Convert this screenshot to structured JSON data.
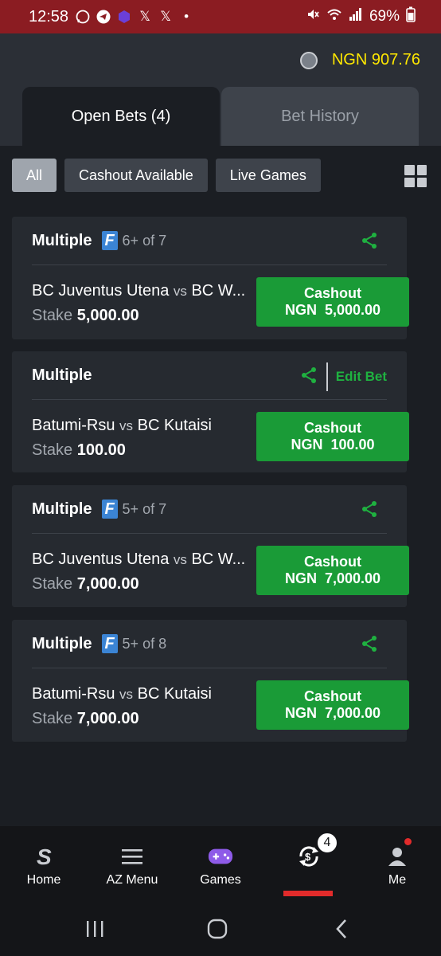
{
  "status_bar": {
    "time": "12:58",
    "battery": "69%",
    "app_icons": [
      "whatsapp-icon",
      "telegram-icon",
      "app-icon",
      "x-icon",
      "x-icon",
      "dot"
    ]
  },
  "header": {
    "balance": "NGN 907.76"
  },
  "tabs": [
    {
      "label": "Open Bets (4)",
      "active": true
    },
    {
      "label": "Bet History",
      "active": false
    }
  ],
  "filters": [
    {
      "label": "All",
      "active": true
    },
    {
      "label": "Cashout Available",
      "active": false
    },
    {
      "label": "Live Games",
      "active": false
    }
  ],
  "bets": [
    {
      "type": "Multiple",
      "badge": "F",
      "of": "6+ of 7",
      "home": "BC Juventus Utena",
      "vs": "vs",
      "away": "BC W...",
      "stake_label": "Stake",
      "stake": "5,000.00",
      "cashout_label": "Cashout",
      "cashout_amount": "NGN  5,000.00",
      "edit": ""
    },
    {
      "type": "Multiple",
      "badge": "",
      "of": "",
      "home": "Batumi-Rsu",
      "vs": "vs",
      "away": "BC Kutaisi",
      "stake_label": "Stake",
      "stake": "100.00",
      "cashout_label": "Cashout",
      "cashout_amount": "NGN  100.00",
      "edit": "Edit Bet"
    },
    {
      "type": "Multiple",
      "badge": "F",
      "of": "5+ of 7",
      "home": "BC Juventus Utena",
      "vs": "vs",
      "away": "BC W...",
      "stake_label": "Stake",
      "stake": "7,000.00",
      "cashout_label": "Cashout",
      "cashout_amount": "NGN  7,000.00",
      "edit": ""
    },
    {
      "type": "Multiple",
      "badge": "F",
      "of": "5+ of 8",
      "home": "Batumi-Rsu",
      "vs": "vs",
      "away": "BC Kutaisi",
      "stake_label": "Stake",
      "stake": "7,000.00",
      "cashout_label": "Cashout",
      "cashout_amount": "NGN  7,000.00",
      "edit": ""
    }
  ],
  "bottom_nav": {
    "items": [
      {
        "label": "Home",
        "icon": "logo-s-icon"
      },
      {
        "label": "AZ Menu",
        "icon": "menu-icon"
      },
      {
        "label": "Games",
        "icon": "gamepad-icon"
      },
      {
        "label": "",
        "icon": "cashout-icon"
      },
      {
        "label": "Me",
        "icon": "user-icon"
      }
    ],
    "cashout_badge": "4"
  },
  "colors": {
    "accent_green": "#1a9b37",
    "balance_yellow": "#ffe800",
    "status_bar": "#8b1c22",
    "active_red": "#e22b2b"
  }
}
